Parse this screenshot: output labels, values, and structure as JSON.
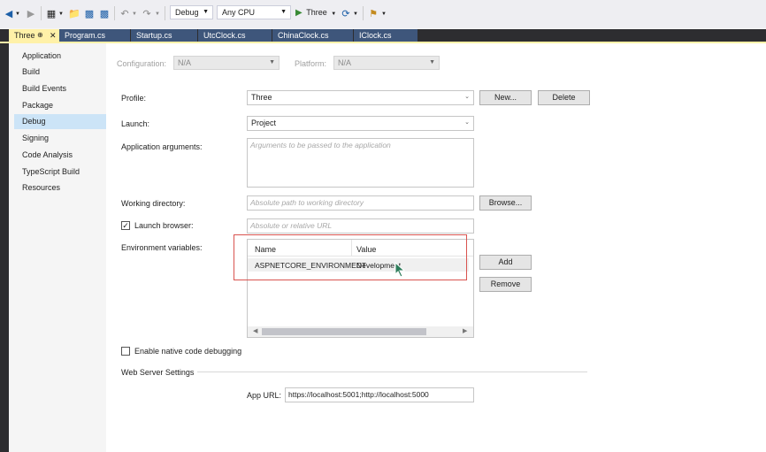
{
  "toolbar": {
    "config": "Debug",
    "platform": "Any CPU",
    "run_target": "Three"
  },
  "tabs": [
    {
      "label": "Three"
    },
    {
      "label": "Program.cs"
    },
    {
      "label": "Startup.cs"
    },
    {
      "label": "UtcClock.cs"
    },
    {
      "label": "ChinaClock.cs"
    },
    {
      "label": "IClock.cs"
    }
  ],
  "nav": {
    "items": [
      "Application",
      "Build",
      "Build Events",
      "Package",
      "Debug",
      "Signing",
      "Code Analysis",
      "TypeScript Build",
      "Resources"
    ],
    "selected": "Debug"
  },
  "form": {
    "configuration_label": "Configuration:",
    "configuration_value": "N/A",
    "platform_label": "Platform:",
    "platform_value": "N/A",
    "profile_label": "Profile:",
    "profile_value": "Three",
    "new_button": "New...",
    "delete_button": "Delete",
    "launch_label": "Launch:",
    "launch_value": "Project",
    "app_args_label": "Application arguments:",
    "app_args_placeholder": "Arguments to be passed to the application",
    "workdir_label": "Working directory:",
    "workdir_placeholder": "Absolute path to working directory",
    "browse_button": "Browse...",
    "launch_browser_label": "Launch browser:",
    "launch_browser_checked": true,
    "launch_browser_placeholder": "Absolute or relative URL",
    "env_label": "Environment variables:",
    "env_columns": [
      "Name",
      "Value"
    ],
    "env_rows": [
      {
        "name": "ASPNETCORE_ENVIRONMENT",
        "value": "Development"
      }
    ],
    "add_button": "Add",
    "remove_button": "Remove",
    "native_debug_label": "Enable native code debugging",
    "web_server_heading": "Web Server Settings",
    "app_url_label": "App URL:",
    "app_url_value": "https://localhost:5001;http://localhost:5000"
  }
}
